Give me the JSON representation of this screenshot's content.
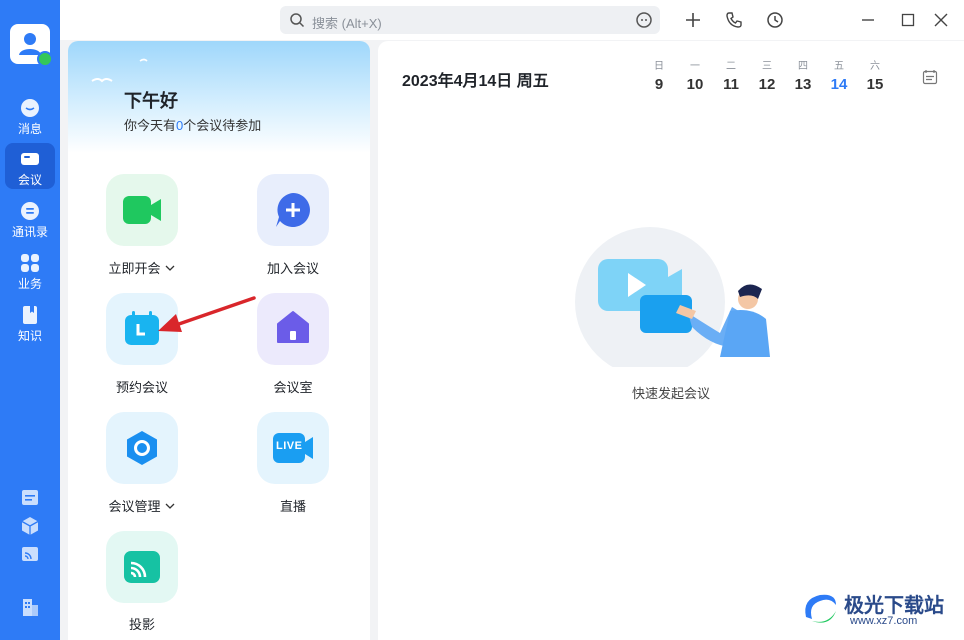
{
  "sidebar": {
    "items": [
      {
        "label": "消息",
        "icon": "message-icon"
      },
      {
        "label": "会议",
        "icon": "meeting-icon",
        "active": true
      },
      {
        "label": "通讯录",
        "icon": "contacts-icon"
      },
      {
        "label": "业务",
        "icon": "apps-icon"
      },
      {
        "label": "知识",
        "icon": "knowledge-icon"
      }
    ],
    "bottom_icons": [
      "calendar-icon",
      "cube-icon",
      "cast-icon",
      "building-icon"
    ]
  },
  "titlebar": {
    "search_placeholder": "搜索 (Alt+X)"
  },
  "welcome": {
    "greeting": "下午好",
    "sub_prefix": "你今天有",
    "sub_count": "0",
    "sub_suffix": "个会议待参加"
  },
  "actions": {
    "start": "立即开会",
    "join": "加入会议",
    "schedule": "预约会议",
    "room": "会议室",
    "manage": "会议管理",
    "live": "直播",
    "live_badge": "LIVE",
    "cast": "投影"
  },
  "calendar": {
    "date_title": "2023年4月14日 周五",
    "week": [
      {
        "wd": "日",
        "d": "9"
      },
      {
        "wd": "一",
        "d": "10"
      },
      {
        "wd": "二",
        "d": "11"
      },
      {
        "wd": "三",
        "d": "12"
      },
      {
        "wd": "四",
        "d": "13"
      },
      {
        "wd": "五",
        "d": "14",
        "today": true
      },
      {
        "wd": "六",
        "d": "15"
      }
    ]
  },
  "empty_state": {
    "label": "快速发起会议"
  },
  "watermark": {
    "name": "极光下载站",
    "url": "www.xz7.com"
  },
  "colors": {
    "accent": "#2e7bf6",
    "rail": "#2e7bf6",
    "start_green": "#1fc85f",
    "annotation_arrow": "#d9262b"
  }
}
